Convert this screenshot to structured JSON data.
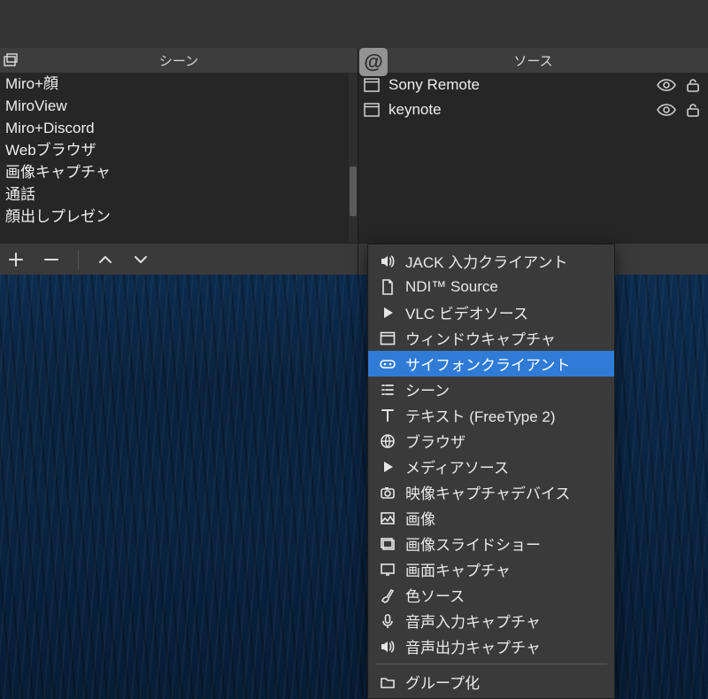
{
  "panels": {
    "scenes": {
      "title": "シーン",
      "items": [
        {
          "label": "Miro+顔"
        },
        {
          "label": "MiroView"
        },
        {
          "label": "Miro+Discord"
        },
        {
          "label": "Webブラウザ"
        },
        {
          "label": "画像キャプチャ"
        },
        {
          "label": "通話"
        },
        {
          "label": "顔出しプレゼン"
        }
      ]
    },
    "sources": {
      "title": "ソース",
      "items": [
        {
          "label": "Sony Remote",
          "icon": "window"
        },
        {
          "label": "keynote",
          "icon": "window"
        }
      ]
    }
  },
  "floating": {
    "at": "@"
  },
  "menu": {
    "items": [
      {
        "icon": "speaker",
        "label": "JACK 入力クライアント"
      },
      {
        "icon": "doc",
        "label": "NDI™ Source"
      },
      {
        "icon": "play",
        "label": "VLC ビデオソース"
      },
      {
        "icon": "window",
        "label": "ウィンドウキャプチャ"
      },
      {
        "icon": "game",
        "label": "サイフォンクライアント",
        "highlighted": true
      },
      {
        "icon": "list",
        "label": "シーン"
      },
      {
        "icon": "text",
        "label": "テキスト (FreeType 2)"
      },
      {
        "icon": "globe",
        "label": "ブラウザ"
      },
      {
        "icon": "play",
        "label": "メディアソース"
      },
      {
        "icon": "camera",
        "label": "映像キャプチャデバイス"
      },
      {
        "icon": "image",
        "label": "画像"
      },
      {
        "icon": "slides",
        "label": "画像スライドショー"
      },
      {
        "icon": "monitor",
        "label": "画面キャプチャ"
      },
      {
        "icon": "brush",
        "label": "色ソース"
      },
      {
        "icon": "mic",
        "label": "音声入力キャプチャ"
      },
      {
        "icon": "speaker",
        "label": "音声出力キャプチャ"
      }
    ],
    "footer": {
      "icon": "folder",
      "label": "グループ化"
    }
  }
}
